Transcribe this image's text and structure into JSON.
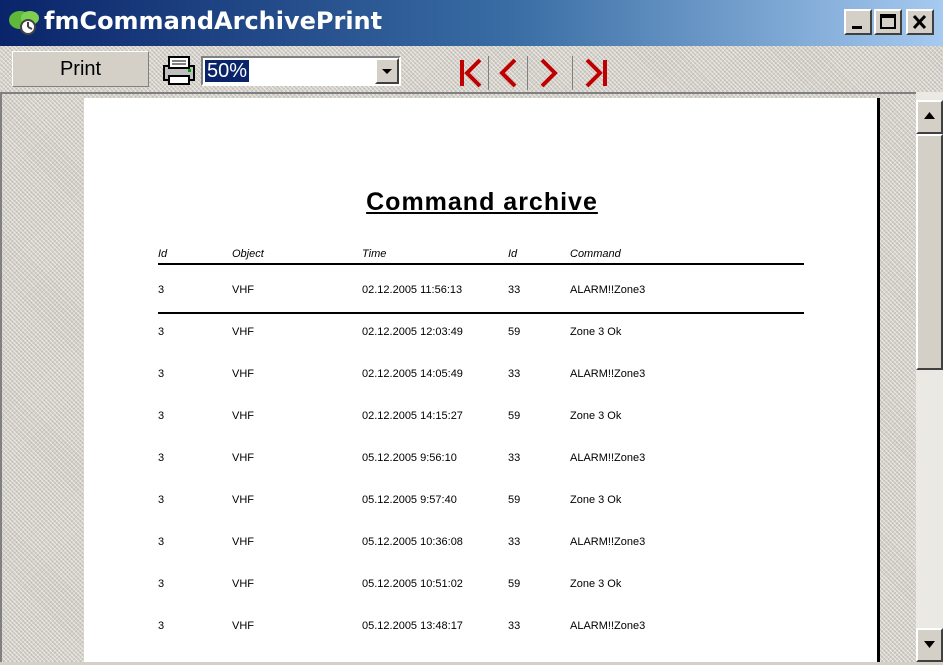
{
  "window": {
    "title": "fmCommandArchivePrint"
  },
  "toolbar": {
    "print_label": "Print",
    "zoom_value": "50%"
  },
  "report": {
    "title": "Command archive",
    "columns": [
      "Id",
      "Object",
      "Time",
      "Id",
      "Command"
    ],
    "rows": [
      [
        "3",
        "VHF",
        "02.12.2005 11:56:13",
        "33",
        "ALARM!!Zone3"
      ],
      [
        "3",
        "VHF",
        "02.12.2005 12:03:49",
        "59",
        "Zone 3 Ok"
      ],
      [
        "3",
        "VHF",
        "02.12.2005 14:05:49",
        "33",
        "ALARM!!Zone3"
      ],
      [
        "3",
        "VHF",
        "02.12.2005 14:15:27",
        "59",
        "Zone 3 Ok"
      ],
      [
        "3",
        "VHF",
        "05.12.2005 9:56:10",
        "33",
        "ALARM!!Zone3"
      ],
      [
        "3",
        "VHF",
        "05.12.2005 9:57:40",
        "59",
        "Zone 3 Ok"
      ],
      [
        "3",
        "VHF",
        "05.12.2005 10:36:08",
        "33",
        "ALARM!!Zone3"
      ],
      [
        "3",
        "VHF",
        "05.12.2005 10:51:02",
        "59",
        "Zone 3 Ok"
      ],
      [
        "3",
        "VHF",
        "05.12.2005 13:48:17",
        "33",
        "ALARM!!Zone3"
      ]
    ]
  },
  "colors": {
    "titlebar_start": "#0a246a",
    "nav_arrows": "#c00000",
    "selection": "#0a246a"
  },
  "icons": [
    "app-icon",
    "minimize-icon",
    "maximize-icon",
    "close-icon",
    "printer-icon",
    "dropdown-arrow-icon",
    "first-page-icon",
    "prev-page-icon",
    "next-page-icon",
    "last-page-icon",
    "scroll-up-icon",
    "scroll-down-icon"
  ]
}
